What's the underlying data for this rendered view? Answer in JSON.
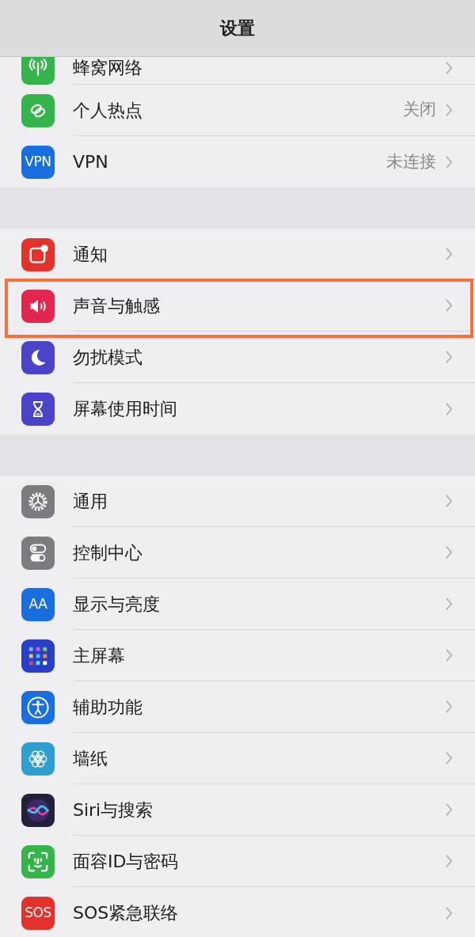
{
  "nav_bar": {
    "title": "设置"
  },
  "groups": [
    {
      "partial_top": true,
      "items": [
        {
          "label": "蜂窝网络",
          "kind": "cellular",
          "color": "#34b44a",
          "highlighted": false
        },
        {
          "label": "个人热点",
          "value": "关闭",
          "kind": "hotspot",
          "color": "#34b44a",
          "highlighted": false
        },
        {
          "label": "VPN",
          "value": "未连接",
          "kind": "text",
          "icon_text": "VPN",
          "color": "#1a6fe0",
          "highlighted": false
        }
      ]
    },
    {
      "partial_top": false,
      "items": [
        {
          "label": "通知",
          "kind": "notification",
          "color": "#e2322b",
          "highlighted": false
        },
        {
          "label": "声音与触感",
          "kind": "sound",
          "color": "#e2264f",
          "highlighted": true
        },
        {
          "label": "勿扰模式",
          "kind": "moon",
          "color": "#4b44c8",
          "highlighted": false
        },
        {
          "label": "屏幕使用时间",
          "kind": "hourglass",
          "color": "#4b44c8",
          "highlighted": false
        }
      ]
    },
    {
      "partial_top": false,
      "items": [
        {
          "label": "通用",
          "kind": "gear",
          "color": "#7c7c80",
          "highlighted": false
        },
        {
          "label": "控制中心",
          "kind": "toggles",
          "color": "#7c7c80",
          "highlighted": false
        },
        {
          "label": "显示与亮度",
          "kind": "text",
          "icon_text": "AA",
          "color": "#1a6fe0",
          "highlighted": false
        },
        {
          "label": "主屏幕",
          "kind": "grid",
          "color": "#2a3fc8",
          "highlighted": false
        },
        {
          "label": "辅助功能",
          "kind": "accessibility",
          "color": "#1a6fe0",
          "highlighted": false
        },
        {
          "label": "墙纸",
          "kind": "flower",
          "color": "#2f9fd0",
          "highlighted": false
        },
        {
          "label": "Siri与搜索",
          "kind": "siri",
          "color": "#24203a",
          "highlighted": false
        },
        {
          "label": "面容ID与密码",
          "kind": "faceid",
          "color": "#34b44a",
          "highlighted": false
        },
        {
          "label": "SOS紧急联络",
          "kind": "text",
          "icon_text": "SOS",
          "color": "#e2322b",
          "highlighted": false
        }
      ]
    }
  ]
}
